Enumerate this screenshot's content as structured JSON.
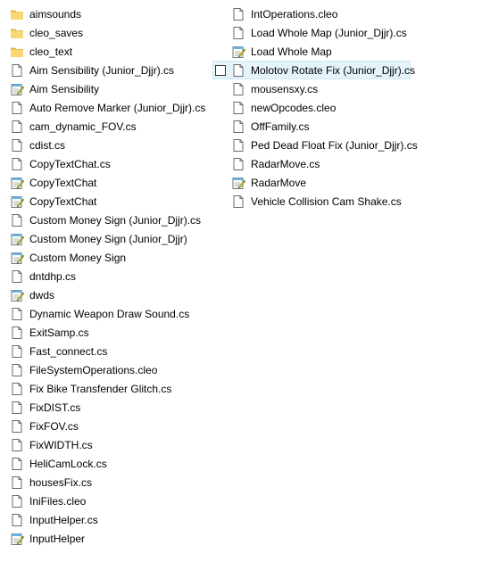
{
  "columns": [
    [
      {
        "name": "aimsounds",
        "icon": "folder-icon"
      },
      {
        "name": "cleo_saves",
        "icon": "folder-icon"
      },
      {
        "name": "cleo_text",
        "icon": "folder-icon"
      },
      {
        "name": "Aim Sensibility (Junior_Djjr).cs",
        "icon": "file-icon"
      },
      {
        "name": "Aim Sensibility",
        "icon": "notepad-icon"
      },
      {
        "name": "Auto Remove Marker (Junior_Djjr).cs",
        "icon": "file-icon"
      },
      {
        "name": "cam_dynamic_FOV.cs",
        "icon": "file-icon"
      },
      {
        "name": "cdist.cs",
        "icon": "file-icon"
      },
      {
        "name": "CopyTextChat.cs",
        "icon": "file-icon"
      },
      {
        "name": "CopyTextChat",
        "icon": "notepad-icon"
      },
      {
        "name": "CopyTextChat",
        "icon": "notepad-icon"
      },
      {
        "name": "Custom Money Sign (Junior_Djjr).cs",
        "icon": "file-icon"
      },
      {
        "name": "Custom Money Sign (Junior_Djjr)",
        "icon": "notepad-icon"
      },
      {
        "name": "Custom Money Sign",
        "icon": "notepad-icon"
      },
      {
        "name": "dntdhp.cs",
        "icon": "file-icon"
      },
      {
        "name": "dwds",
        "icon": "notepad-icon"
      },
      {
        "name": "Dynamic Weapon Draw Sound.cs",
        "icon": "file-icon"
      },
      {
        "name": "ExitSamp.cs",
        "icon": "file-icon"
      },
      {
        "name": "Fast_connect.cs",
        "icon": "file-icon"
      },
      {
        "name": "FileSystemOperations.cleo",
        "icon": "file-icon"
      },
      {
        "name": "Fix Bike Transfender Glitch.cs",
        "icon": "file-icon"
      },
      {
        "name": "FixDIST.cs",
        "icon": "file-icon"
      },
      {
        "name": "FixFOV.cs",
        "icon": "file-icon"
      },
      {
        "name": "FixWIDTH.cs",
        "icon": "file-icon"
      },
      {
        "name": "HeliCamLock.cs",
        "icon": "file-icon"
      },
      {
        "name": "housesFix.cs",
        "icon": "file-icon"
      },
      {
        "name": "IniFiles.cleo",
        "icon": "file-icon"
      },
      {
        "name": "InputHelper.cs",
        "icon": "file-icon"
      },
      {
        "name": "InputHelper",
        "icon": "notepad-icon"
      }
    ],
    [
      {
        "name": "IntOperations.cleo",
        "icon": "file-icon"
      },
      {
        "name": "Load Whole Map (Junior_Djjr).cs",
        "icon": "file-icon"
      },
      {
        "name": "Load Whole Map",
        "icon": "notepad-icon"
      },
      {
        "name": "Molotov Rotate Fix (Junior_Djjr).cs",
        "icon": "file-icon",
        "hover": true
      },
      {
        "name": "mousensxy.cs",
        "icon": "file-icon"
      },
      {
        "name": "newOpcodes.cleo",
        "icon": "file-icon"
      },
      {
        "name": "OffFamily.cs",
        "icon": "file-icon"
      },
      {
        "name": "Ped Dead Float Fix (Junior_Djjr).cs",
        "icon": "file-icon"
      },
      {
        "name": "RadarMove.cs",
        "icon": "file-icon"
      },
      {
        "name": "RadarMove",
        "icon": "notepad-icon"
      },
      {
        "name": "Vehicle Collision Cam Shake.cs",
        "icon": "file-icon"
      }
    ]
  ],
  "colors": {
    "folder": "#f8d775",
    "folder_dark": "#e0b24a",
    "hover_bg": "#e5f3fb",
    "hover_border": "#cde8f7"
  }
}
